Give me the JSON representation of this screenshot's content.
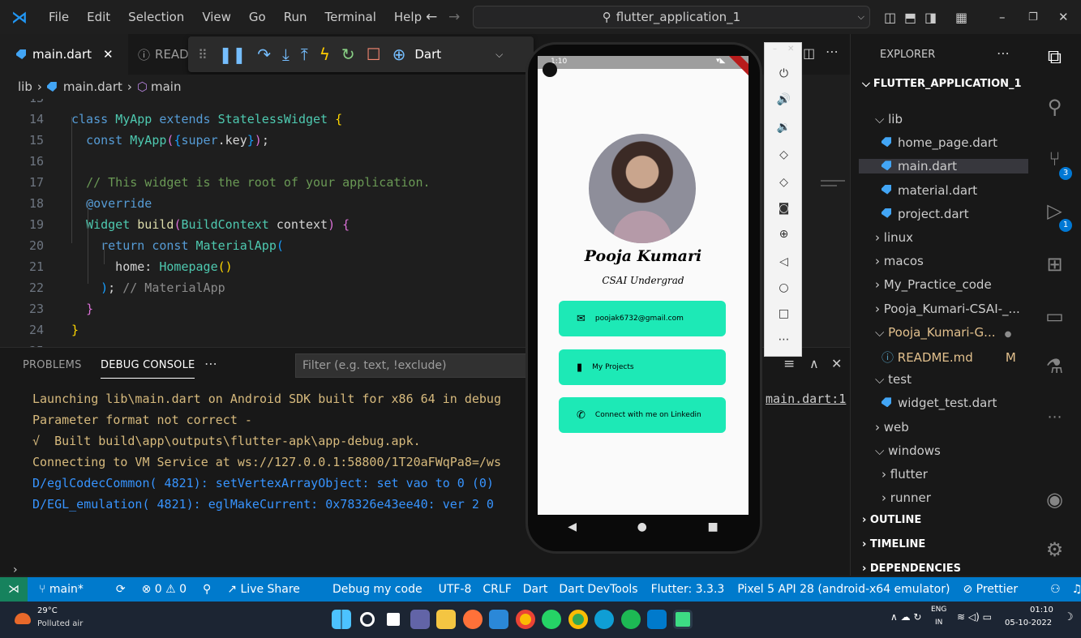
{
  "menu": {
    "items": [
      "File",
      "Edit",
      "Selection",
      "View",
      "Go",
      "Run",
      "Terminal",
      "Help"
    ]
  },
  "search": {
    "text": "flutter_application_1"
  },
  "tabs": [
    {
      "label": "main.dart"
    },
    {
      "label": "READ"
    }
  ],
  "debug_toolbar": {
    "config": "Dart"
  },
  "breadcrumb": [
    "lib",
    "main.dart",
    "main"
  ],
  "editor": {
    "lines": [
      {
        "n": "13",
        "t": ""
      },
      {
        "n": "14",
        "t": "class MyApp extends StatelessWidget {"
      },
      {
        "n": "15",
        "t": "  const MyApp({super.key});"
      },
      {
        "n": "16",
        "t": ""
      },
      {
        "n": "17",
        "t": "  // This widget is the root of your application."
      },
      {
        "n": "18",
        "t": "  @override"
      },
      {
        "n": "19",
        "t": "  Widget build(BuildContext context) {"
      },
      {
        "n": "20",
        "t": "    return const MaterialApp("
      },
      {
        "n": "21",
        "t": "      home: Homepage()"
      },
      {
        "n": "22",
        "t": "    ); // MaterialApp"
      },
      {
        "n": "23",
        "t": "  }"
      },
      {
        "n": "24",
        "t": "}"
      },
      {
        "n": "25",
        "t": ""
      }
    ]
  },
  "panel": {
    "tabs": [
      "PROBLEMS",
      "DEBUG CONSOLE"
    ],
    "filter_placeholder": "Filter (e.g. text, !exclude)",
    "link": "main.dart:1",
    "output": [
      "Launching lib\\main.dart on Android SDK built for x86 64 in debug",
      "Parameter format not correct -",
      "√  Built build\\app\\outputs\\flutter-apk\\app-debug.apk.",
      "Connecting to VM Service at ws://127.0.0.1:58800/1T20aFWqPa8=/ws",
      "D/eglCodecCommon( 4821): setVertexArrayObject: set vao to 0 (0)",
      "D/EGL_emulation( 4821): eglMakeCurrent: 0x78326e43ee40: ver 2 0"
    ]
  },
  "explorer": {
    "title": "EXPLORER",
    "project": "FLUTTER_APPLICATION_1",
    "items": [
      {
        "label": "lib",
        "kind": "folder-open"
      },
      {
        "label": "home_page.dart",
        "kind": "dart"
      },
      {
        "label": "main.dart",
        "kind": "dart"
      },
      {
        "label": "material.dart",
        "kind": "dart"
      },
      {
        "label": "project.dart",
        "kind": "dart"
      },
      {
        "label": "linux",
        "kind": "folder"
      },
      {
        "label": "macos",
        "kind": "folder"
      },
      {
        "label": "My_Practice_code",
        "kind": "folder"
      },
      {
        "label": "Pooja_Kumari-CSAI-_...",
        "kind": "folder"
      },
      {
        "label": "Pooja_Kumari-G...",
        "kind": "folder-open"
      },
      {
        "label": "README.md",
        "kind": "info",
        "badge": "M"
      },
      {
        "label": "test",
        "kind": "folder-open"
      },
      {
        "label": "widget_test.dart",
        "kind": "dart"
      },
      {
        "label": "web",
        "kind": "folder"
      },
      {
        "label": "windows",
        "kind": "folder-open"
      },
      {
        "label": "flutter",
        "kind": "folder"
      },
      {
        "label": "runner",
        "kind": "folder"
      }
    ],
    "sections": [
      "OUTLINE",
      "TIMELINE",
      "DEPENDENCIES"
    ]
  },
  "activity": {
    "scm_badge": "3",
    "debug_badge": "1"
  },
  "phone": {
    "name": "Pooja Kumari",
    "subtitle": "CSAI Undergrad",
    "cards": [
      {
        "label": "poojak6732@gmail.com",
        "icon": "mail-icon"
      },
      {
        "label": "My Projects",
        "icon": "file-icon"
      },
      {
        "label": "Connect with me on Linkedin",
        "icon": "phone-icon"
      }
    ],
    "status_time": "1:10"
  },
  "statusbar": {
    "branch": "main*",
    "problems": "⊗ 0 ⚠ 0",
    "live_share": "Live Share",
    "debug": "Debug my code",
    "encoding": "UTF-8",
    "eol": "CRLF",
    "language": "Dart",
    "devtools": "Dart DevTools",
    "flutter": "Flutter: 3.3.3",
    "device": "Pixel 5 API 28 (android-x64 emulator)",
    "prettier": "Prettier"
  },
  "taskbar": {
    "temp": "29°C",
    "weather": "Polluted air",
    "lang": "ENG",
    "region": "IN",
    "time": "01:10",
    "date": "05-10-2022"
  },
  "colors": {
    "accent": "#007acc",
    "card": "#1de9b6",
    "console_yellow": "#d7ba7d",
    "console_blue": "#3794ff"
  }
}
